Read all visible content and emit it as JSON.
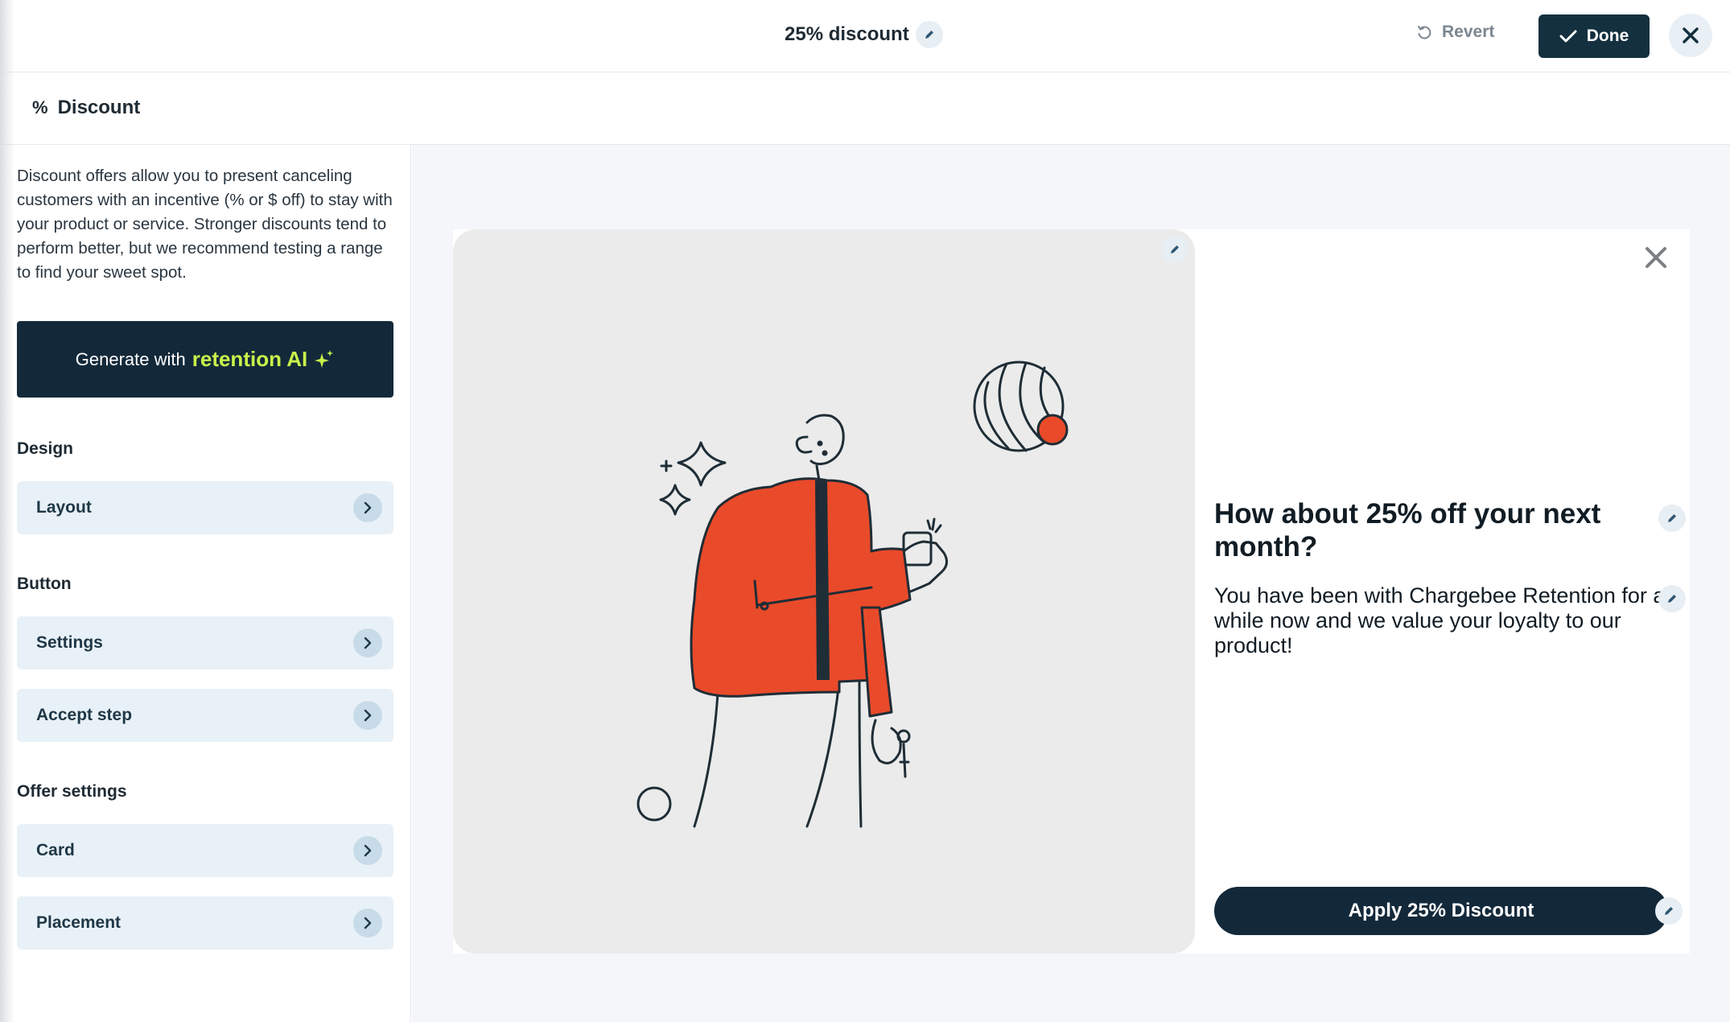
{
  "header": {
    "title": "25% discount",
    "revert_label": "Revert",
    "done_label": "Done"
  },
  "section": {
    "icon_symbol": "%",
    "title": "Discount"
  },
  "sidebar": {
    "description": "Discount offers allow you to present canceling customers with an incentive (% or $ off) to stay with your product or service. Stronger discounts tend to perform better, but we recommend testing a range to find your sweet spot.",
    "generate": {
      "label": "Generate with",
      "brand": "retention AI"
    },
    "groups": [
      {
        "label": "Design",
        "items": [
          {
            "label": "Layout"
          }
        ]
      },
      {
        "label": "Button",
        "items": [
          {
            "label": "Settings"
          },
          {
            "label": "Accept step"
          }
        ]
      },
      {
        "label": "Offer settings",
        "items": [
          {
            "label": "Card"
          },
          {
            "label": "Placement"
          }
        ]
      }
    ]
  },
  "preview": {
    "headline": "How about 25% off your next month?",
    "body": "You have been with Chargebee Retention for a while now and we value your loyalty to our product!",
    "button_label": "Apply 25% Discount",
    "illustration": "person-holding-phone-illustration"
  },
  "colors": {
    "primary_dark": "#13293a",
    "accent_lime": "#c9f24a",
    "illustration_orange": "#e94a2a",
    "nav_item_bg": "#e8f1f7"
  }
}
